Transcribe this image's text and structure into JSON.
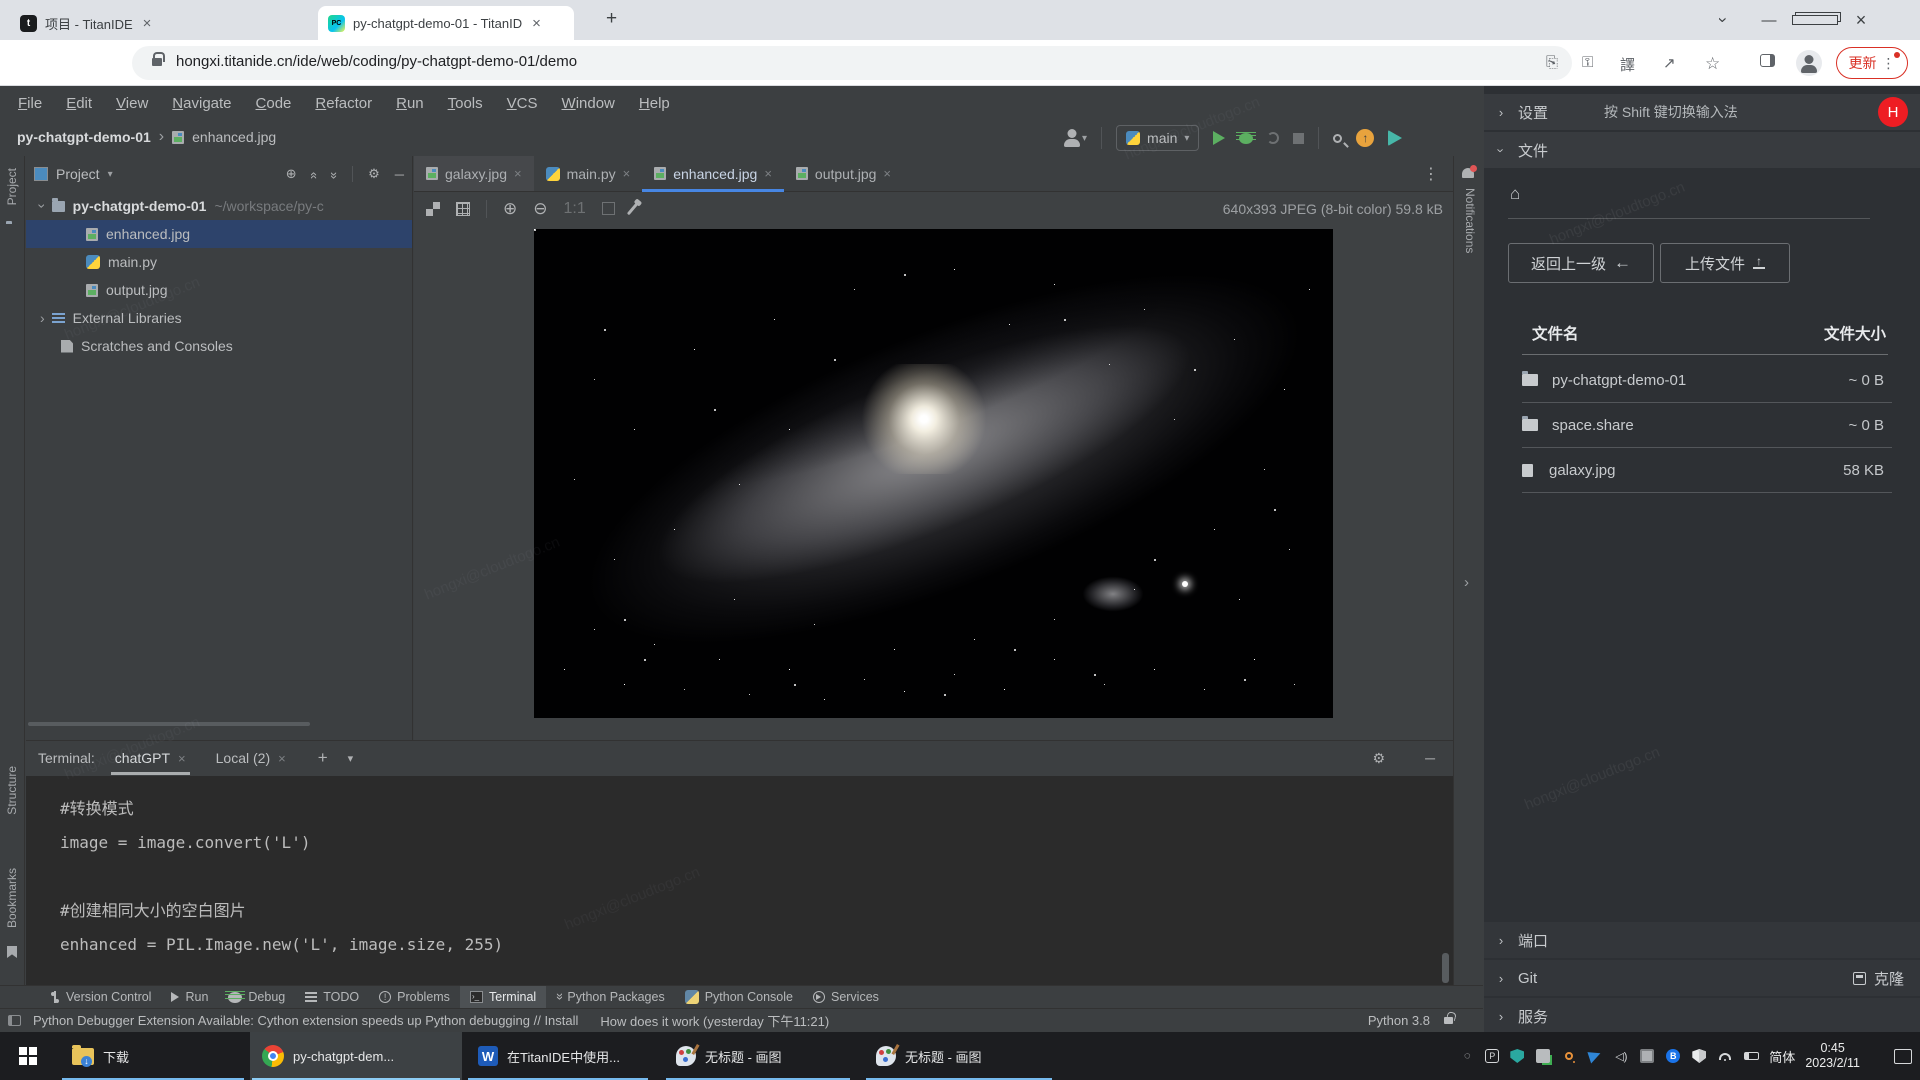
{
  "browser": {
    "tab1": "项目 - TitanIDE",
    "tab2": "py-chatgpt-demo-01 - TitanID",
    "tab1_favicon": "t",
    "tab2_favicon": "PC",
    "url": "hongxi.titanide.cn/ide/web/coding/py-chatgpt-demo-01/demo",
    "update_label": "更新"
  },
  "menu": {
    "items": [
      "File",
      "Edit",
      "View",
      "Navigate",
      "Code",
      "Refactor",
      "Run",
      "Tools",
      "VCS",
      "Window",
      "Help"
    ]
  },
  "header": {
    "breadcrumb_project": "py-chatgpt-demo-01",
    "breadcrumb_file": "enhanced.jpg",
    "run_config": "main"
  },
  "stripes": {
    "project": "Project",
    "structure": "Structure",
    "bookmarks": "Bookmarks",
    "notifications": "Notifications"
  },
  "project": {
    "title": "Project",
    "root_name": "py-chatgpt-demo-01",
    "root_path": "~/workspace/py-c",
    "children": [
      "enhanced.jpg",
      "main.py",
      "output.jpg"
    ],
    "libs": "External Libraries",
    "scratches": "Scratches and Consoles"
  },
  "editor": {
    "tabs": [
      "galaxy.jpg",
      "main.py",
      "enhanced.jpg",
      "output.jpg"
    ],
    "zoom_label": "1:1",
    "info": "640x393 JPEG (8-bit color) 59.8 kB"
  },
  "terminal": {
    "label": "Terminal:",
    "tab1": "chatGPT",
    "tab2": "Local (2)",
    "lines": [
      "#转换模式",
      "image = image.convert('L')",
      "",
      "#创建相同大小的空白图片",
      "enhanced = PIL.Image.new('L', image.size, 255)"
    ]
  },
  "toolbar_bottom": {
    "items": [
      "Version Control",
      "Run",
      "Debug",
      "TODO",
      "Problems",
      "Terminal",
      "Python Packages",
      "Python Console",
      "Services"
    ]
  },
  "statusbar": {
    "message": "Python Debugger Extension Available: Cython extension speeds up Python debugging // Install",
    "message2": "How does it work (yesterday 下午11:21)",
    "python": "Python 3.8"
  },
  "right_panel": {
    "settings": "设置",
    "ime_hint": "按 Shift 键切换输入法",
    "avatar": "H",
    "files": "文件",
    "back": "返回上一级",
    "upload": "上传文件",
    "col_name": "文件名",
    "col_size": "文件大小",
    "rows": [
      {
        "name": "py-chatgpt-demo-01",
        "size": "~ 0 B",
        "type": "folder"
      },
      {
        "name": "space.share",
        "size": "~ 0 B",
        "type": "folder"
      },
      {
        "name": "galaxy.jpg",
        "size": "58 KB",
        "type": "file"
      }
    ],
    "ports": "端口",
    "git": "Git",
    "clone": "克隆",
    "services": "服务"
  },
  "taskbar": {
    "apps": [
      {
        "label": "下载"
      },
      {
        "label": "py-chatgpt-dem..."
      },
      {
        "label": "在TitanIDE中使用..."
      },
      {
        "label": "无标题 - 画图"
      },
      {
        "label": "无标题 - 画图"
      }
    ],
    "ime": "简体",
    "time": "0:45",
    "date": "2023/2/11"
  },
  "watermark": "hongxi@cloudtogo.cn"
}
